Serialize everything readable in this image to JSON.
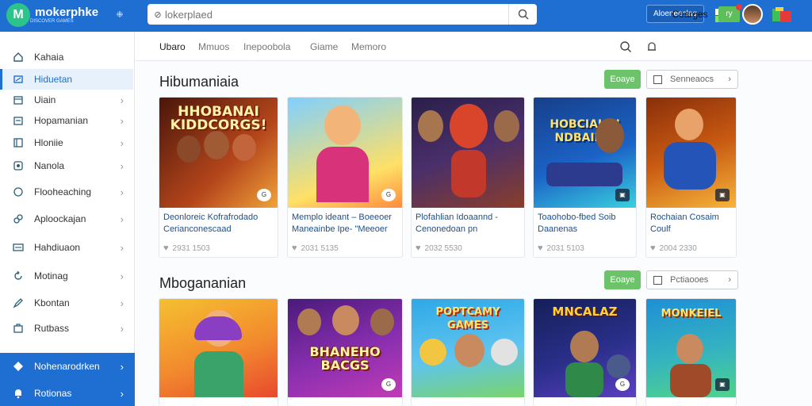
{
  "app": {
    "name": "mokerphke",
    "tagline": "DISCOVER GAMES",
    "search_placeholder": "lokerplaed",
    "top_button": "Aloeneeclag"
  },
  "sidebar": {
    "items": [
      {
        "label": "Kahaia",
        "icon": "home-icon",
        "chevron": false
      },
      {
        "label": "Hiduetan",
        "icon": "gamepad-icon",
        "chevron": false,
        "active": true
      },
      {
        "label": "Uiain",
        "icon": "calendar-icon",
        "chevron": true
      },
      {
        "label": "Hopamanian",
        "icon": "inbox-icon",
        "chevron": true
      },
      {
        "label": "Hloniie",
        "icon": "window-icon",
        "chevron": true
      },
      {
        "label": "Nanola",
        "icon": "star-icon",
        "chevron": true
      },
      {
        "label": "Flooheaching",
        "icon": "moon-icon",
        "chevron": true
      },
      {
        "label": "Aploockajan",
        "icon": "link-icon",
        "chevron": true
      },
      {
        "label": "Hahdiuaon",
        "icon": "list-icon",
        "chevron": true
      },
      {
        "label": "Motinag",
        "icon": "refresh-icon",
        "chevron": true
      },
      {
        "label": "Kbontan",
        "icon": "pen-icon",
        "chevron": true
      },
      {
        "label": "Rutbass",
        "icon": "bag-icon",
        "chevron": true
      }
    ],
    "bottom": [
      {
        "label": "Nohenarodrken",
        "icon": "diamond-icon"
      },
      {
        "label": "Rotionas",
        "icon": "bell-icon"
      }
    ]
  },
  "tabs": {
    "items": [
      "Ubaro",
      "Mmuos",
      "Inepoobola",
      "Giame",
      "Memoro"
    ],
    "active": "Coarges",
    "badge": "ry"
  },
  "sections": [
    {
      "title": "Hibumaniaia",
      "button": "Eoaye",
      "filter": "Senneaocs",
      "cards": [
        {
          "art": "HHOBANAI\nKIDDCORGS!",
          "title": "Deonloreic Kofrafrodado Cerianconescaad",
          "meta": "2931 1503",
          "bg": [
            "#5a1d0e",
            "#b5461b"
          ]
        },
        {
          "art": "",
          "title": "Memplo ideant – Boeeoer Maneainbe Ipe- \"Meeoer",
          "meta": "2031 5135",
          "bg": [
            "#6fc6ff",
            "#ffe066"
          ]
        },
        {
          "art": "",
          "title": "Plofahlian Idoaannd - Cenonedoan pn",
          "meta": "2032 5530",
          "bg": [
            "#2a1f4a",
            "#8a3e2a"
          ]
        },
        {
          "art": "HOBCIAIAN\nNDBAIIBS",
          "title": "Toaohobo-fbed Soib Daanenas",
          "meta": "2031 5103",
          "bg": [
            "#1b4fa6",
            "#3ad0e0"
          ]
        },
        {
          "art": "",
          "title": "Rochaian Cosaim Coulf",
          "meta": "2004 2330",
          "bg": [
            "#c85a12",
            "#f7b53b"
          ]
        }
      ]
    },
    {
      "title": "Mbogananian",
      "button": "Eoaye",
      "filter": "Pctiaooes",
      "cards": [
        {
          "art": "",
          "title": "",
          "meta": "",
          "bg": [
            "#f5c030",
            "#e8492e"
          ]
        },
        {
          "art": "BHANEHO\nBACGS",
          "title": "",
          "meta": "",
          "bg": [
            "#5a1f8f",
            "#c13bb5"
          ]
        },
        {
          "art": "POPTCAMY\nGAMES",
          "title": "",
          "meta": "",
          "bg": [
            "#2fa8e6",
            "#7ad46b"
          ]
        },
        {
          "art": "MNCALAZ",
          "title": "",
          "meta": "",
          "bg": [
            "#1d2a7a",
            "#5c3fc2"
          ]
        },
        {
          "art": "MONKEIEL",
          "title": "",
          "meta": "",
          "bg": [
            "#1f8fd6",
            "#4fd38c"
          ]
        }
      ]
    }
  ]
}
